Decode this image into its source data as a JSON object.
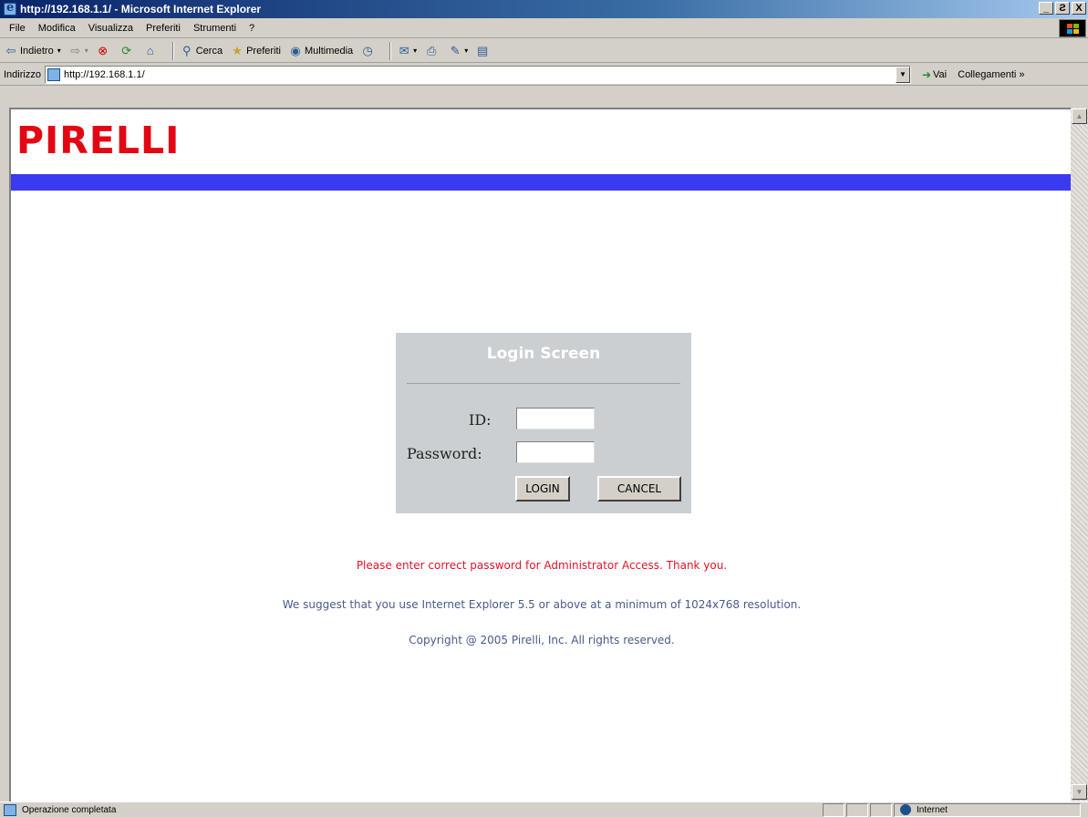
{
  "window": {
    "title": "http://192.168.1.1/ - Microsoft Internet Explorer",
    "controls": [
      "_",
      "Ƨ",
      "X"
    ]
  },
  "menu": {
    "items": [
      "File",
      "Modifica",
      "Visualizza",
      "Preferiti",
      "Strumenti",
      "?"
    ]
  },
  "toolbar": {
    "back_label": "Indietro",
    "search_label": "Cerca",
    "favorites_label": "Preferiti",
    "multimedia_label": "Multimedia"
  },
  "address": {
    "label": "Indirizzo",
    "url": "http://192.168.1.1/",
    "go_label": "Vai",
    "links_label": "Collegamenti »"
  },
  "page": {
    "logo_text": "PIRELLI",
    "login": {
      "title": "Login Screen",
      "id_label": "ID:",
      "password_label": "Password:",
      "id_value": "",
      "password_value": "",
      "login_button": "LOGIN",
      "cancel_button": "CANCEL"
    },
    "messages": {
      "warning": "Please enter correct password for Administrator Access. Thank you.",
      "suggestion": "We suggest that you use Internet Explorer 5.5 or above at a minimum of 1024x768 resolution.",
      "copyright": "Copyright @ 2005 Pirelli, Inc. All rights reserved."
    }
  },
  "status": {
    "text": "Operazione completata",
    "zone": "Internet"
  },
  "colors": {
    "logo_red": "#e30613",
    "band_blue": "#3a3af0",
    "warning_red": "#e0142a",
    "info_blue": "#4a5a8c",
    "login_box": "#cbcfd1"
  }
}
